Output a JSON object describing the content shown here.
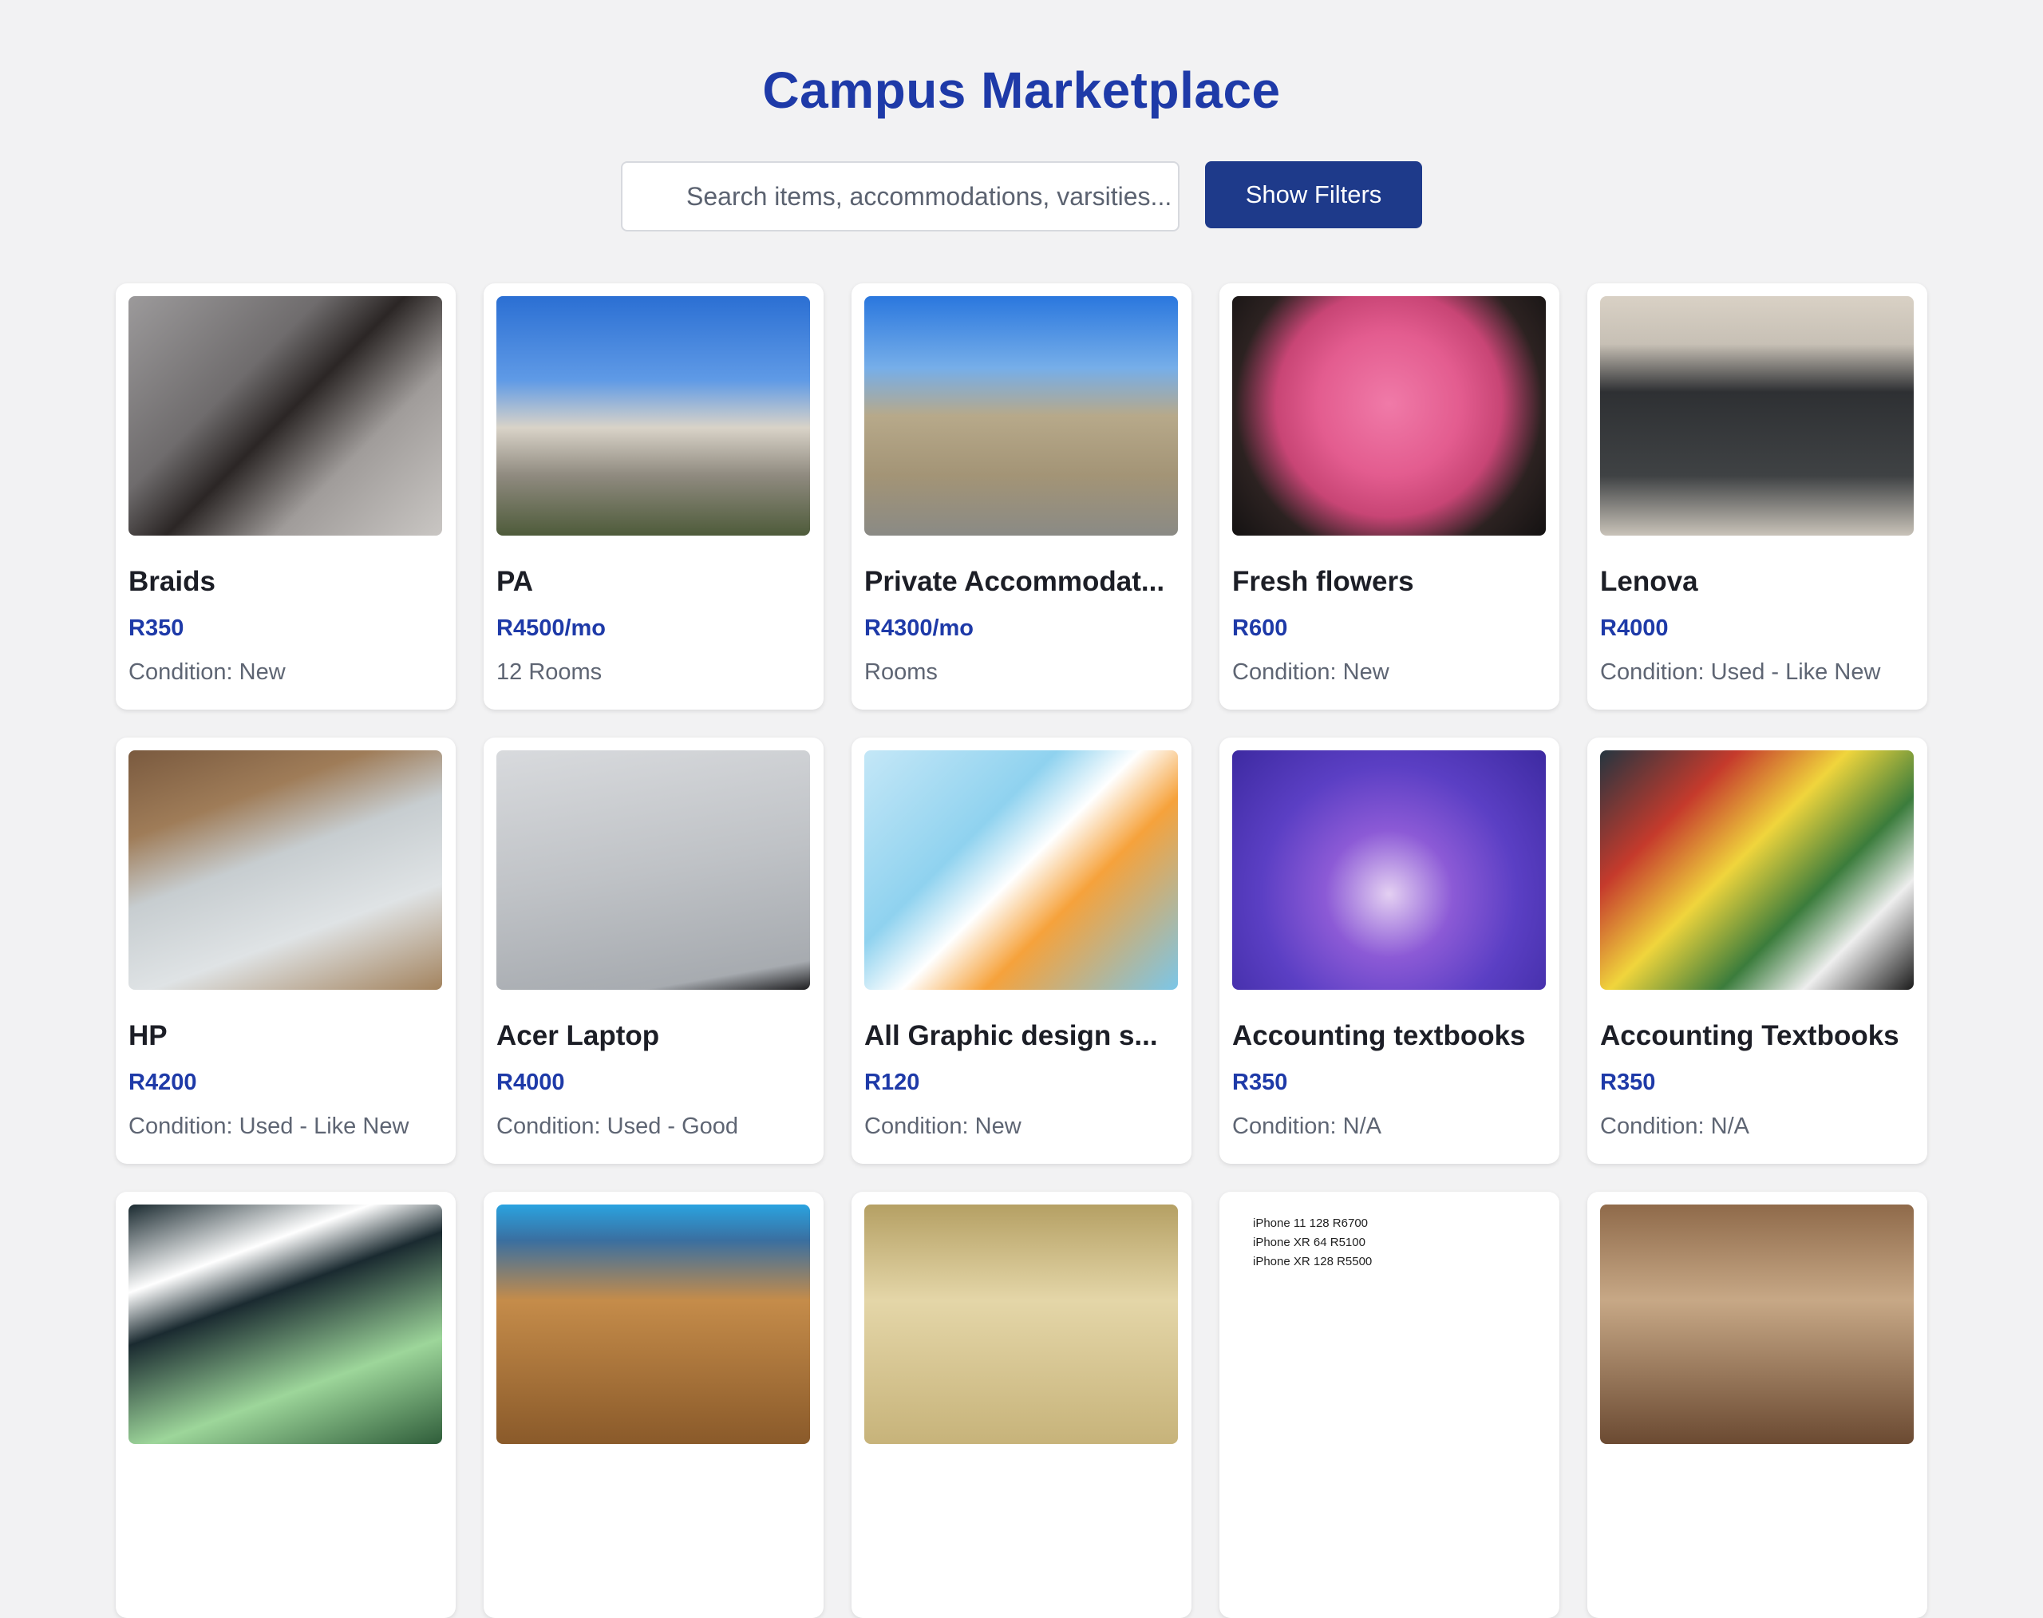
{
  "header": {
    "title": "Campus Marketplace"
  },
  "search": {
    "placeholder": "Search items, accommodations, varsities..."
  },
  "filters": {
    "label": "Show Filters"
  },
  "colors": {
    "accent": "#1e3aa8",
    "button": "#1e3a8a",
    "background": "#f2f2f3"
  },
  "listings": [
    {
      "title": "Braids",
      "price": "R350",
      "meta": "Condition: New",
      "image": "braids-photo"
    },
    {
      "title": "PA",
      "price": "R4500/mo",
      "meta": "12 Rooms",
      "image": "apartment-building-photo"
    },
    {
      "title": "Private Accommodat...",
      "price": "R4300/mo",
      "meta": "Rooms",
      "image": "townhouses-photo"
    },
    {
      "title": "Fresh flowers",
      "price": "R600",
      "meta": "Condition: New",
      "image": "roses-bouquet-photo"
    },
    {
      "title": "Lenova",
      "price": "R4000",
      "meta": "Condition: Used - Like New",
      "image": "laptop-photo"
    },
    {
      "title": "HP",
      "price": "R4200",
      "meta": "Condition: Used - Like New",
      "image": "laptop-underside-photo"
    },
    {
      "title": "Acer Laptop",
      "price": "R4000",
      "meta": "Condition: Used - Good",
      "image": "acer-lid-photo"
    },
    {
      "title": "All Graphic design s...",
      "price": "R120",
      "meta": "Condition: New",
      "image": "graphic-design-poster"
    },
    {
      "title": "Accounting textbooks",
      "price": "R350",
      "meta": "Condition: N/A",
      "image": "income-tax-book-photo"
    },
    {
      "title": "Accounting Textbooks",
      "price": "R350",
      "meta": "Condition: N/A",
      "image": "textbooks-collage-photo"
    }
  ],
  "partial_row": {
    "phone_lines": [
      "iPhone 11 128 R6700",
      "iPhone XR 64 R5100",
      "iPhone XR 128 R5500"
    ]
  }
}
